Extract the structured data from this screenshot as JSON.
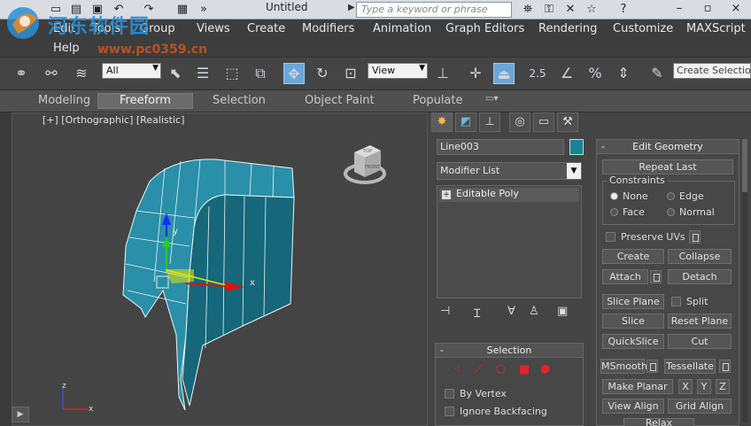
{
  "titlebar": {
    "title": "Untitled",
    "search_placeholder": "Type a keyword or phrase"
  },
  "logo": {
    "text": "河东软件园",
    "url": "www.pc0359.cn"
  },
  "menu": {
    "items": [
      "Edit",
      "Tools",
      "Group",
      "Views",
      "Create",
      "Modifiers",
      "Animation",
      "Graph Editors",
      "Rendering",
      "Customize",
      "MAXScript"
    ],
    "help": "Help"
  },
  "toolbar": {
    "filter_value": "All",
    "ref_coord_value": "View",
    "snap_value": "2.5",
    "selection_set_placeholder": "Create Selection Set"
  },
  "ribbon": {
    "tabs": [
      "Modeling",
      "Freeform",
      "Selection",
      "Object Paint",
      "Populate"
    ],
    "active": "Freeform"
  },
  "viewport": {
    "label": "[+] [Orthographic] [Realistic]",
    "viewcube_top": "TOP",
    "viewcube_front": "FRONT",
    "axis_x": "x",
    "axis_y": "y",
    "axis_z": "z",
    "mesh_color": "#2a8fa8"
  },
  "command_panel": {
    "object_name": "Line003",
    "object_color": "#1e7f9b",
    "modifier_list": "Modifier List",
    "stack_item": "Editable Poly",
    "selection": {
      "title": "Selection",
      "by_vertex": "By Vertex",
      "ignore_backfacing": "Ignore Backfacing"
    },
    "edit_geometry": {
      "title": "Edit Geometry",
      "repeat_last": "Repeat Last",
      "constraints_title": "Constraints",
      "none": "None",
      "edge": "Edge",
      "face": "Face",
      "normal": "Normal",
      "preserve_uvs": "Preserve UVs",
      "create": "Create",
      "collapse": "Collapse",
      "attach": "Attach",
      "detach": "Detach",
      "slice_plane": "Slice Plane",
      "split": "Split",
      "slice": "Slice",
      "reset_plane": "Reset Plane",
      "quickslice": "QuickSlice",
      "cut": "Cut",
      "msmooth": "MSmooth",
      "tessellate": "Tessellate",
      "make_planar": "Make Planar",
      "x": "X",
      "y": "Y",
      "z": "Z",
      "view_align": "View Align",
      "grid_align": "Grid Align",
      "relax": "Relax"
    }
  }
}
